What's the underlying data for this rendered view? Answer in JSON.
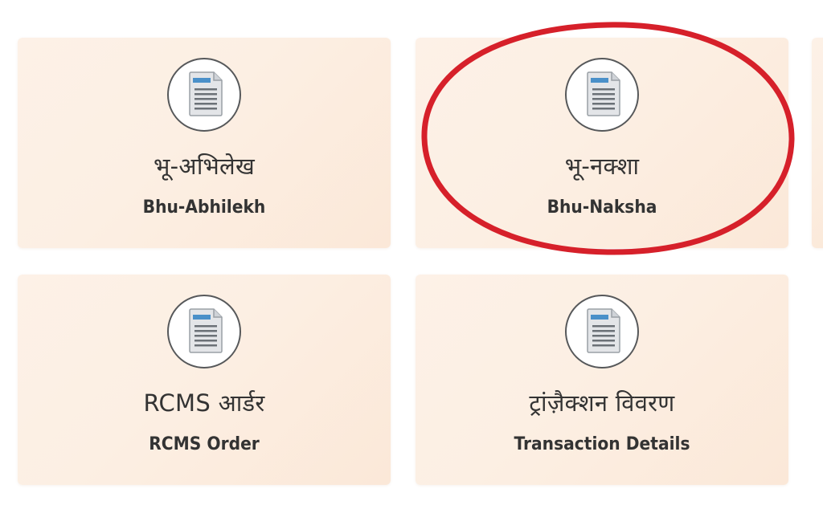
{
  "tiles": [
    {
      "hindi": "भू-अभिलेख",
      "english": "Bhu-Abhilekh",
      "icon": "document-icon"
    },
    {
      "hindi": "भू-नक्शा",
      "english": "Bhu-Naksha",
      "icon": "document-icon"
    },
    {
      "hindi": "RCMS आर्डर",
      "english": "RCMS Order",
      "icon": "document-icon"
    },
    {
      "hindi": "ट्रांज़ैक्शन विवरण",
      "english": "Transaction Details",
      "icon": "document-icon"
    }
  ],
  "highlight": {
    "target": "Bhu-Naksha",
    "color": "#d6202a"
  },
  "colors": {
    "card_background": "#fcefe3",
    "icon_border": "#56585a",
    "icon_header": "#4a90c9",
    "text": "#333333"
  }
}
